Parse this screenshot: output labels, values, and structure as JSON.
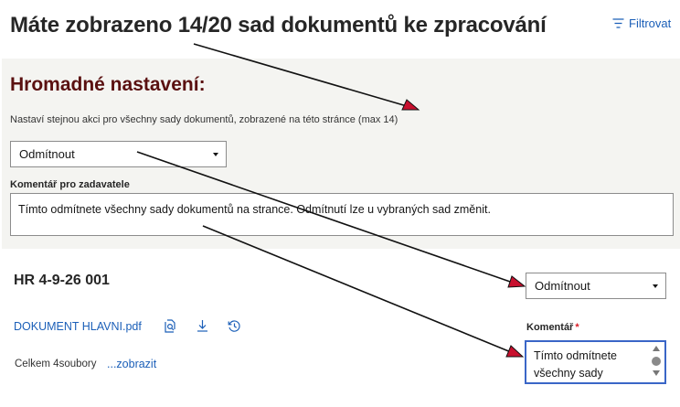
{
  "header": {
    "title": "Máte zobrazeno 14/20 sad dokumentů ke zpracování",
    "filter_label": "Filtrovat"
  },
  "bulk": {
    "title": "Hromadné nastavení:",
    "description": "Nastaví stejnou akci pro všechny sady dokumentů, zobrazené na této stránce (max 14)",
    "action_value": "Odmítnout",
    "comment_label": "Komentář pro zadavatele",
    "comment_text": "Tímto odmítnete všechny sady dokumentů na strancе. Odmítnutí lze u vybraných sad změnit."
  },
  "document_set": {
    "id": "HR 4-9-26 001",
    "action_value": "Odmítnout",
    "file_name": "DOKUMENT HLAVNI.pdf",
    "total_label": "Celkem 4soubory",
    "show_link": "...zobrazit",
    "comment_label": "Komentář",
    "required_mark": "*",
    "comment_text": "Tímto odmítnete všechny sady"
  },
  "icons": {
    "filter": "filter-icon",
    "preview": "preview-icon",
    "download": "download-icon",
    "history": "history-icon"
  },
  "colors": {
    "link": "#1b5fb8",
    "bulk_title": "#5a1010",
    "panel_bg": "#f4f4f1",
    "focus_border": "#3a66c7",
    "annotation_arrow": "#111111",
    "arrow_head": "#c8102e"
  }
}
